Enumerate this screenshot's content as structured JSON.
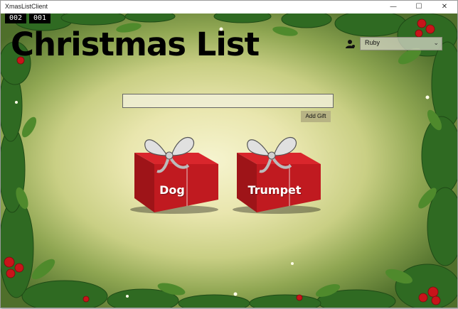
{
  "window": {
    "title": "XmasListClient"
  },
  "window_controls": {
    "minimize": "—",
    "maximize": "☐",
    "close": "✕"
  },
  "counters": {
    "left": "002",
    "right": "001"
  },
  "header": {
    "title": "Christmas List"
  },
  "user": {
    "selected": "Ruby",
    "icon": "user-icon"
  },
  "gift_entry": {
    "value": "",
    "placeholder": ""
  },
  "add_gift_button": {
    "label": "Add Gift"
  },
  "gifts": [
    {
      "label": "Dog"
    },
    {
      "label": "Trumpet"
    }
  ],
  "colors": {
    "box_red": "#b8191e",
    "bow_silver": "#d6d6d6",
    "holly_green": "#2f6a22",
    "berry_red": "#c8141a"
  }
}
